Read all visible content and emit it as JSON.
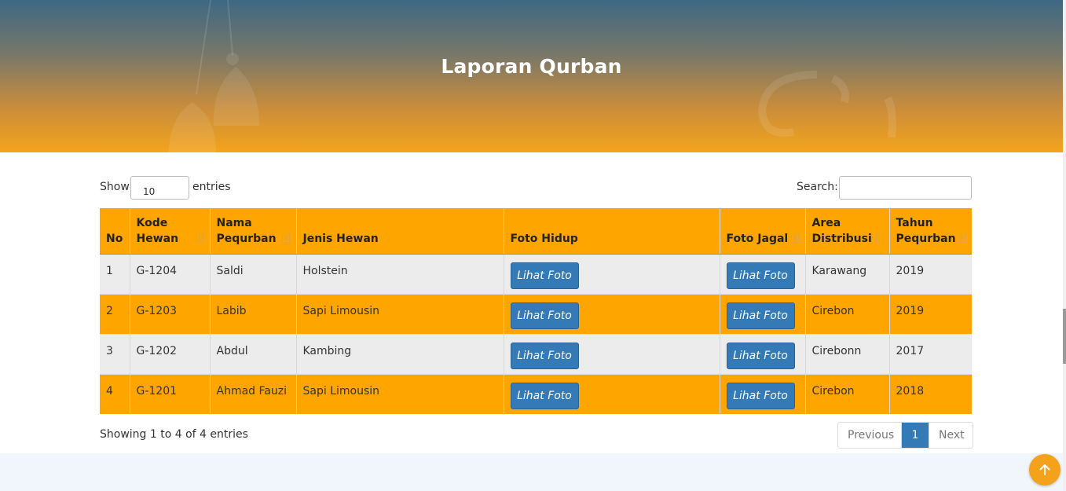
{
  "page": {
    "title": "Laporan Qurban"
  },
  "controls": {
    "show_label": "Show",
    "length_value": "10",
    "entries_label": "entries",
    "search_label": "Search:",
    "search_value": ""
  },
  "table": {
    "headers": [
      "No",
      "Kode Hewan",
      "Nama Pequrban",
      "Jenis Hewan",
      "Foto Hidup",
      "Foto Jagal",
      "Area Distribusi",
      "Tahun Pequrban"
    ],
    "rows": [
      {
        "no": "1",
        "kode": "G-1204",
        "nama": "Saldi",
        "jenis": "Holstein",
        "foto_hidup": "Lihat Foto",
        "foto_jagal": "Lihat Foto",
        "area": "Karawang",
        "tahun": "2019"
      },
      {
        "no": "2",
        "kode": "G-1203",
        "nama": "Labib",
        "jenis": "Sapi Limousin",
        "foto_hidup": "Lihat Foto",
        "foto_jagal": "Lihat Foto",
        "area": "Cirebon",
        "tahun": "2019"
      },
      {
        "no": "3",
        "kode": "G-1202",
        "nama": "Abdul",
        "jenis": "Kambing",
        "foto_hidup": "Lihat Foto",
        "foto_jagal": "Lihat Foto",
        "area": "Cirebonn",
        "tahun": "2017"
      },
      {
        "no": "4",
        "kode": "G-1201",
        "nama": "Ahmad Fauzi",
        "jenis": "Sapi Limousin",
        "foto_hidup": "Lihat Foto",
        "foto_jagal": "Lihat Foto",
        "area": "Cirebon",
        "tahun": "2018"
      }
    ]
  },
  "footer": {
    "info": "Showing 1 to 4 of 4 entries",
    "previous": "Previous",
    "current_page": "1",
    "next": "Next"
  },
  "icons": {
    "scroll_top": "arrow-up-icon",
    "sort": "sort-icon"
  },
  "colors": {
    "accent": "#ffa500",
    "button": "#337ab7",
    "header_top": "#3e6883"
  }
}
